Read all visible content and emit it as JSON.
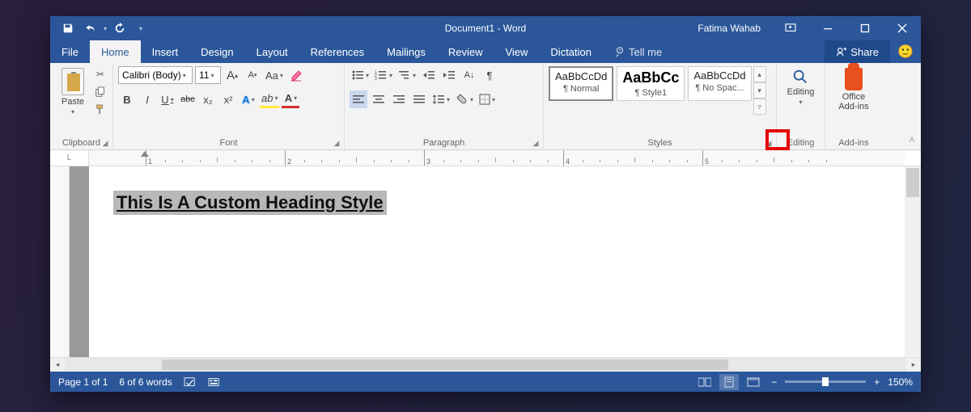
{
  "titlebar": {
    "title": "Document1  -  Word",
    "user": "Fatima Wahab"
  },
  "tabs": {
    "file": "File",
    "home": "Home",
    "insert": "Insert",
    "design": "Design",
    "layout": "Layout",
    "references": "References",
    "mailings": "Mailings",
    "review": "Review",
    "view": "View",
    "dictation": "Dictation",
    "tellme": "Tell me",
    "share": "Share"
  },
  "ribbon": {
    "clipboard": {
      "label": "Clipboard",
      "paste": "Paste"
    },
    "font": {
      "label": "Font",
      "family": "Calibri (Body)",
      "size": "11",
      "grow": "A",
      "shrink": "A",
      "case": "Aa",
      "clear_icon": "clear-formatting-icon",
      "bold": "B",
      "italic": "I",
      "underline": "U",
      "strike": "abc",
      "sub": "x₂",
      "sup": "x²",
      "effects": "A",
      "highlight": "ab",
      "color": "A"
    },
    "paragraph": {
      "label": "Paragraph"
    },
    "styles": {
      "label": "Styles",
      "items": [
        {
          "preview": "AaBbCcDd",
          "name": "¶ Normal",
          "big": false,
          "selected": true
        },
        {
          "preview": "AaBbCc",
          "name": "¶ Style1",
          "big": true,
          "selected": false
        },
        {
          "preview": "AaBbCcDd",
          "name": "¶ No Spac...",
          "big": false,
          "selected": false
        }
      ]
    },
    "editing": {
      "label": "Editing",
      "btn": "Editing"
    },
    "addins": {
      "label": "Add-ins",
      "btn": "Office\nAdd-ins"
    }
  },
  "ruler": {
    "corner": "L",
    "marks": [
      "1",
      "2",
      "3",
      "4",
      "5"
    ]
  },
  "document": {
    "heading": "This Is A Custom Heading Style"
  },
  "statusbar": {
    "page": "Page 1 of 1",
    "words": "6 of 6 words",
    "zoom": "150%"
  }
}
